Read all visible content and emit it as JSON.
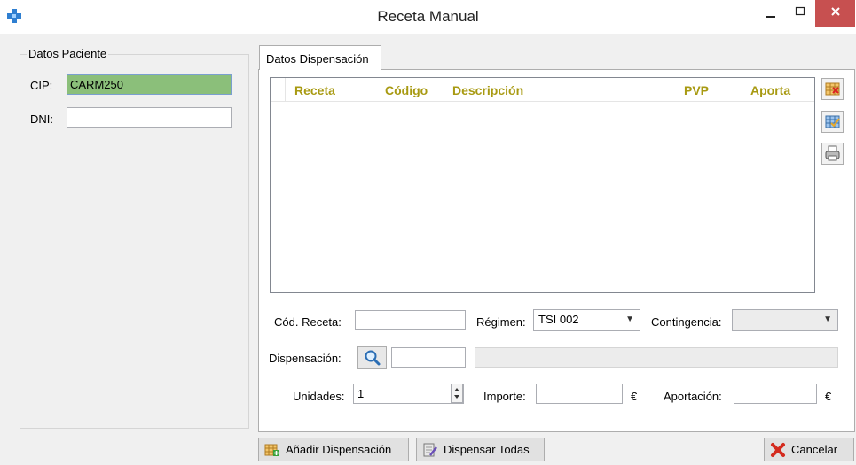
{
  "window": {
    "title": "Receta Manual",
    "minimize": "–",
    "maximize": "☐",
    "close": "✕"
  },
  "patient": {
    "group_title": "Datos Paciente",
    "cip_label": "CIP:",
    "cip_value": "CARM250",
    "dni_label": "DNI:",
    "dni_value": ""
  },
  "dispensation": {
    "tab_label": "Datos Dispensación",
    "grid": {
      "columns": [
        "Receta",
        "Código",
        "Descripción",
        "PVP",
        "Aporta"
      ],
      "rows": []
    },
    "side_buttons": [
      "clear-grid-icon",
      "check-grid-icon",
      "printer-icon"
    ],
    "cod_receta_label": "Cód. Receta:",
    "cod_receta_value": "",
    "regimen_label": "Régimen:",
    "regimen_value": "TSI 002",
    "contingencia_label": "Contingencia:",
    "contingencia_value": "",
    "dispensacion_label": "Dispensación:",
    "dispensacion_value": "",
    "unidades_label": "Unidades:",
    "unidades_value": "1",
    "importe_label": "Importe:",
    "importe_value": "",
    "importe_currency": "€",
    "aportacion_label": "Aportación:",
    "aportacion_value": "",
    "aportacion_currency": "€"
  },
  "buttons": {
    "add_label": "Añadir Dispensación",
    "dispense_all_label": "Dispensar Todas",
    "cancel_label": "Cancelar"
  },
  "colors": {
    "accent_header": "#a89a12",
    "cip_highlight": "#8bbf7a",
    "close_red": "#c75050"
  }
}
